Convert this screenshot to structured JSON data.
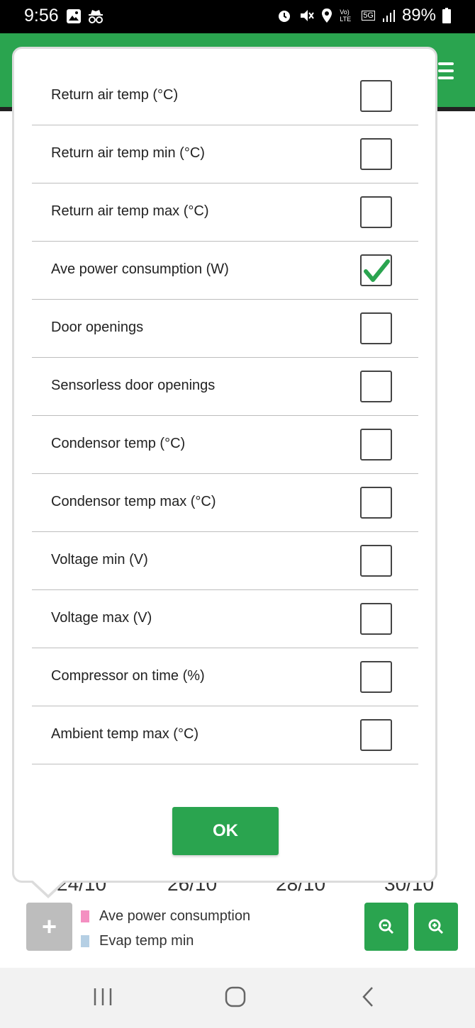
{
  "status_bar": {
    "time": "9:56",
    "battery": "89%",
    "network": "5G",
    "volte": "Vo) LTE"
  },
  "modal": {
    "options": [
      {
        "label": "Return air temp (°C)",
        "checked": false
      },
      {
        "label": "Return air temp min (°C)",
        "checked": false
      },
      {
        "label": "Return air temp max (°C)",
        "checked": false
      },
      {
        "label": "Ave power consumption (W)",
        "checked": true
      },
      {
        "label": "Door openings",
        "checked": false
      },
      {
        "label": "Sensorless door openings",
        "checked": false
      },
      {
        "label": "Condensor temp (°C)",
        "checked": false
      },
      {
        "label": "Condensor temp max (°C)",
        "checked": false
      },
      {
        "label": "Voltage min (V)",
        "checked": false
      },
      {
        "label": "Voltage max (V)",
        "checked": false
      },
      {
        "label": "Compressor on time (%)",
        "checked": false
      },
      {
        "label": "Ambient temp max (°C)",
        "checked": false
      }
    ],
    "ok_label": "OK"
  },
  "chart_footer": {
    "x_ticks": [
      "24/10",
      "26/10",
      "28/10",
      "30/10"
    ],
    "add_label": "+",
    "legend": [
      {
        "label": "Ave power consumption",
        "color": "#f48fc1"
      },
      {
        "label": "Evap temp min",
        "color": "#b5cfe4"
      }
    ]
  },
  "colors": {
    "accent": "#2aa44f",
    "check": "#2aa44f"
  },
  "icons": {
    "zoom_out": "zoom-out-icon",
    "zoom_in": "zoom-in-icon",
    "menu": "menu-icon"
  }
}
